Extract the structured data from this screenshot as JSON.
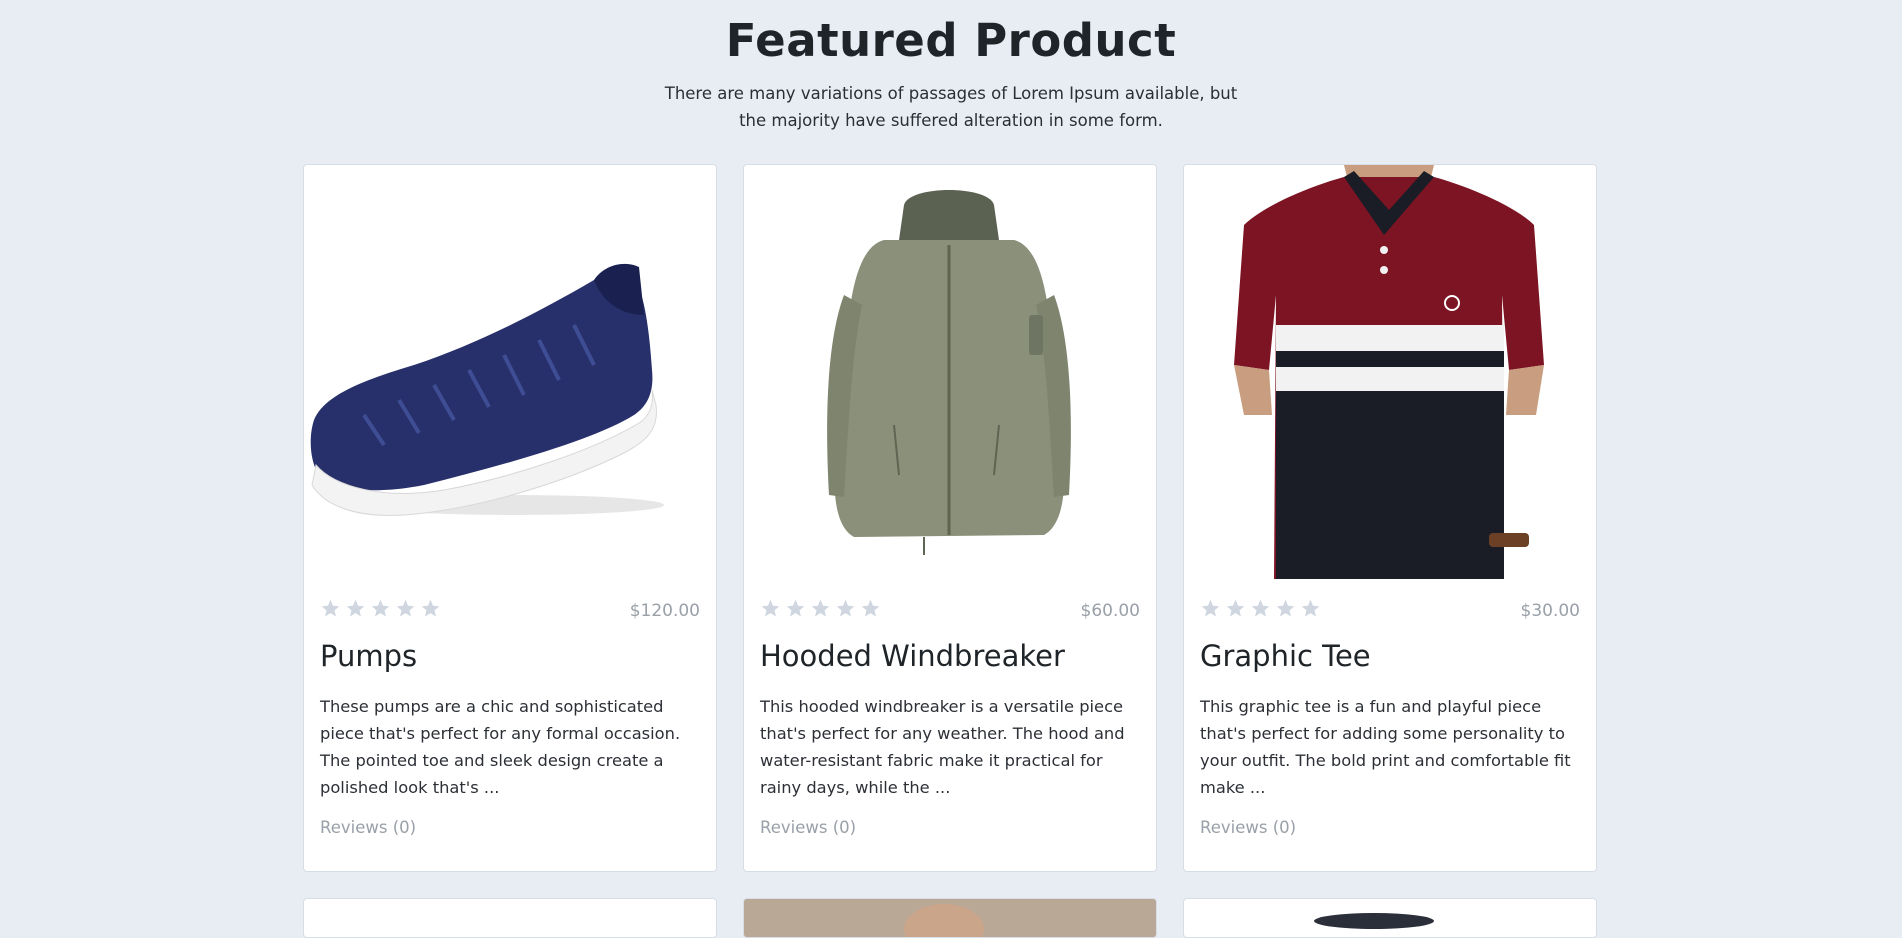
{
  "section": {
    "title": "Featured Product",
    "subtitle": "There are many variations of passages of Lorem Ipsum available, but the majority have suffered alteration in some form."
  },
  "products": [
    {
      "name": "Pumps",
      "price": "$120.00",
      "rating": 0,
      "description": "These pumps are a chic and sophisticated piece that's perfect for any formal occasion. The pointed toe and sleek design create a polished look that's ...",
      "reviews": "Reviews (0)",
      "image": "navy-slip-on-sneaker"
    },
    {
      "name": "Hooded Windbreaker",
      "price": "$60.00",
      "rating": 0,
      "description": "This hooded windbreaker is a versatile piece that's perfect for any weather. The hood and water-resistant fabric make it practical for rainy days, while the ...",
      "reviews": "Reviews (0)",
      "image": "olive-hooded-jacket"
    },
    {
      "name": "Graphic Tee",
      "price": "$30.00",
      "rating": 0,
      "description": "This graphic tee is a fun and playful piece that's perfect for adding some personality to your outfit. The bold print and comfortable fit make ...",
      "reviews": "Reviews (0)",
      "image": "striped-polo-shirt"
    }
  ],
  "colors": {
    "background": "#e8edf4",
    "star_inactive": "#cfd6e0",
    "muted_text": "#9aa0a8"
  }
}
